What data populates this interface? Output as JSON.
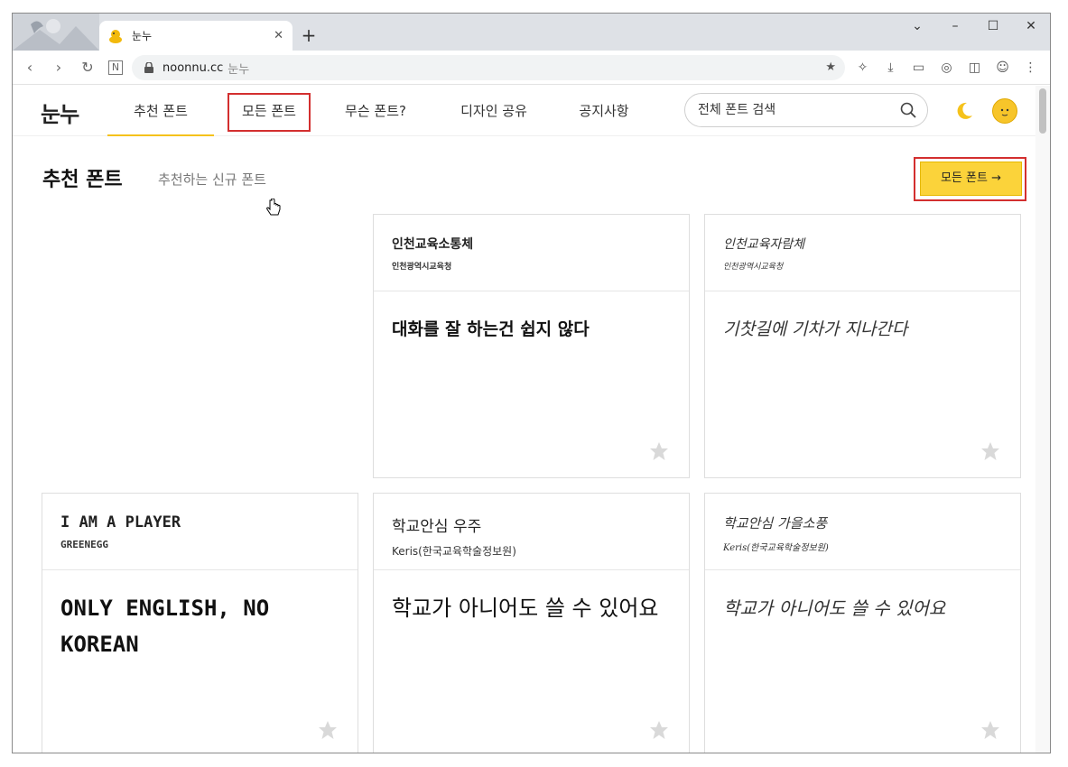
{
  "browser": {
    "tab_title": "눈누",
    "new_tab": "+",
    "url_host": "noonnu.cc",
    "url_title": "눈누",
    "window_controls": [
      "⌄",
      "–",
      "☐",
      "✕"
    ]
  },
  "site": {
    "logo": "눈누",
    "nav": [
      {
        "label": "추천 폰트",
        "active": true
      },
      {
        "label": "모든 폰트",
        "active": false
      },
      {
        "label": "무슨 폰트?",
        "active": false
      },
      {
        "label": "디자인 공유",
        "active": false
      },
      {
        "label": "공지사항",
        "active": false
      }
    ],
    "search_placeholder": "전체 폰트 검색",
    "accent": "#f5c21b"
  },
  "section": {
    "title": "추천 폰트",
    "subtitle": "추천하는 신규 폰트",
    "all_fonts_button": "모든 폰트 →"
  },
  "cards": [
    {
      "name": "인천교육소통체",
      "author": "인천광역시교육청",
      "sample": "대화를 잘 하는건 쉽지 않다"
    },
    {
      "name": "인천교육자람체",
      "author": "인천광역시교육청",
      "sample": "기찻길에 기차가 지나간다"
    },
    {
      "name": "I AM A PLAYER",
      "author": "GREENEGG",
      "sample": "ONLY ENGLISH, NO KOREAN"
    },
    {
      "name": "학교안심 우주",
      "author": "Keris(한국교육학술정보원)",
      "sample": "학교가 아니어도 쓸 수 있어요"
    },
    {
      "name": "학교안심 가을소풍",
      "author": "Keris(한국교육학술정보원)",
      "sample": "학교가 아니어도 쓸 수 있어요"
    }
  ]
}
